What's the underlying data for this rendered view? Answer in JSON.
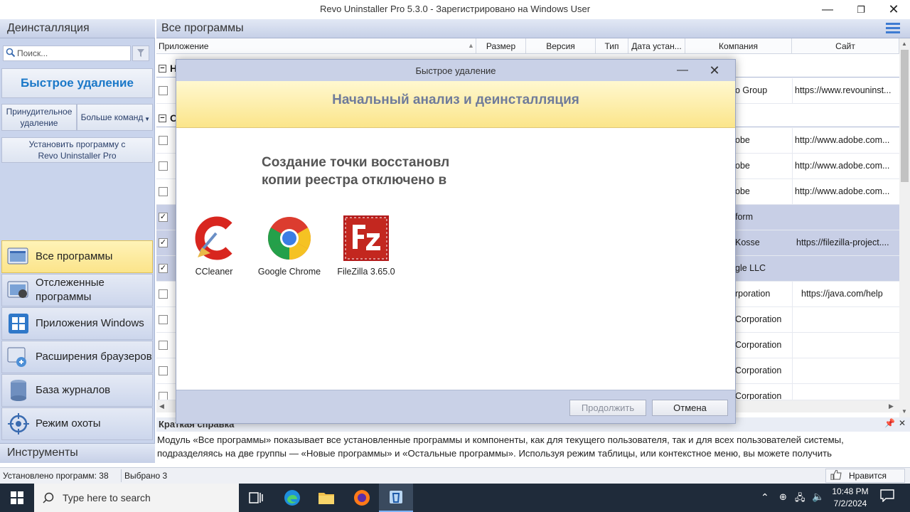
{
  "window": {
    "title": "Revo Uninstaller Pro 5.3.0 - Зарегистрировано на Windows User",
    "minimize": "—",
    "maximize": "❐",
    "close": "✕"
  },
  "left": {
    "header": "Деинсталляция",
    "search_placeholder": "Поиск...",
    "quick_uninstall": "Быстрое удаление",
    "forced_uninstall": "Принудительное удаление",
    "more_commands": "Больше команд",
    "install_with_revo": "Установить программу с Revo Uninstaller Pro",
    "nav": [
      {
        "label": "Все программы",
        "icon": "all-programs-icon"
      },
      {
        "label": "Отслеженные программы",
        "icon": "traced-programs-icon"
      },
      {
        "label": "Приложения Windows",
        "icon": "windows-apps-icon"
      },
      {
        "label": "Расширения браузеров",
        "icon": "browser-extensions-icon"
      },
      {
        "label": "База журналов",
        "icon": "logs-database-icon"
      },
      {
        "label": "Режим охоты",
        "icon": "hunter-mode-icon"
      }
    ],
    "tools": "Инструменты"
  },
  "main": {
    "header": "Все программы",
    "columns": [
      "Приложение",
      "Размер",
      "Версия",
      "Тип",
      "Дата устан...",
      "Компания",
      "Сайт"
    ],
    "groups": [
      "Н",
      "О"
    ],
    "rows": [
      {
        "company": "o Group",
        "site": "https://www.revouninst...",
        "checked": false,
        "selected": false
      },
      {
        "company": "obe",
        "site": "http://www.adobe.com...",
        "checked": false,
        "selected": false
      },
      {
        "company": "obe",
        "site": "http://www.adobe.com...",
        "checked": false,
        "selected": false
      },
      {
        "company": "obe",
        "site": "http://www.adobe.com...",
        "checked": false,
        "selected": false
      },
      {
        "company": "form",
        "site": "",
        "checked": true,
        "selected": true
      },
      {
        "company": "Kosse",
        "site": "https://filezilla-project....",
        "checked": true,
        "selected": true
      },
      {
        "company": "gle LLC",
        "site": "",
        "checked": true,
        "selected": true
      },
      {
        "company": "rporation",
        "site": "https://java.com/help",
        "checked": false,
        "selected": false
      },
      {
        "company": "Corporation",
        "site": "",
        "checked": false,
        "selected": false
      },
      {
        "company": "Corporation",
        "site": "",
        "checked": false,
        "selected": false
      },
      {
        "company": "Corporation",
        "site": "",
        "checked": false,
        "selected": false
      },
      {
        "company": "Corporation",
        "site": "",
        "checked": false,
        "selected": false
      }
    ],
    "help_title": "Краткая справка",
    "help_text": "Модуль «Все программы» показывает все установленные программы и компоненты, как для текущего пользователя, так и для всех пользователей системы, подразделяясь на две группы — «Новые программы» и «Остальные программы». Используя режим таблицы, или контекстное меню, вы можете получить"
  },
  "status": {
    "installed": "Установлено программ: 38",
    "selected": "Выбрано 3",
    "like": "Нравится"
  },
  "dialog": {
    "title": "Быстрое удаление",
    "banner": "Начальный анализ и деинсталляция",
    "message_line1": "Создание точки восстановл",
    "message_line2": "копии реестра отключено в",
    "apps": [
      {
        "name": "CCleaner",
        "icon": "ccleaner-icon"
      },
      {
        "name": "Google Chrome",
        "icon": "chrome-icon"
      },
      {
        "name": "FileZilla 3.65.0",
        "icon": "filezilla-icon"
      }
    ],
    "continue_button": "Продолжить",
    "cancel_button": "Отмена"
  },
  "taskbar": {
    "search_placeholder": "Type here to search",
    "time": "10:48 PM",
    "date": "7/2/2024"
  }
}
